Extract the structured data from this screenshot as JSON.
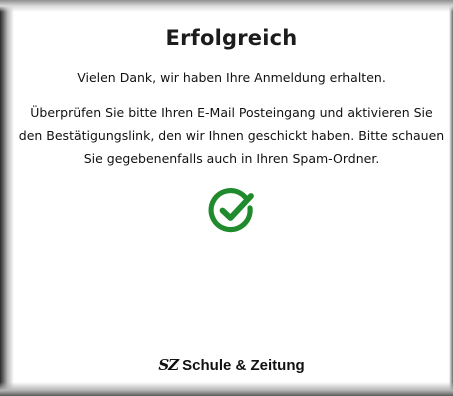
{
  "dialog": {
    "title": "Erfolgreich",
    "thanks": "Vielen Dank, wir haben Ihre Anmeldung erhalten.",
    "instructions": "Überprüfen Sie bitte Ihren E-Mail Posteingang und aktivieren Sie den Bestätigungslink, den wir Ihnen geschickt haben. Bitte schauen Sie gegebenenfalls auch in Ihren Spam-Ordner.",
    "success_icon": "check-circle-icon",
    "success_color": "#1f8b2c"
  },
  "brand": {
    "prefix": "SZ",
    "name": "Schule & Zeitung"
  }
}
